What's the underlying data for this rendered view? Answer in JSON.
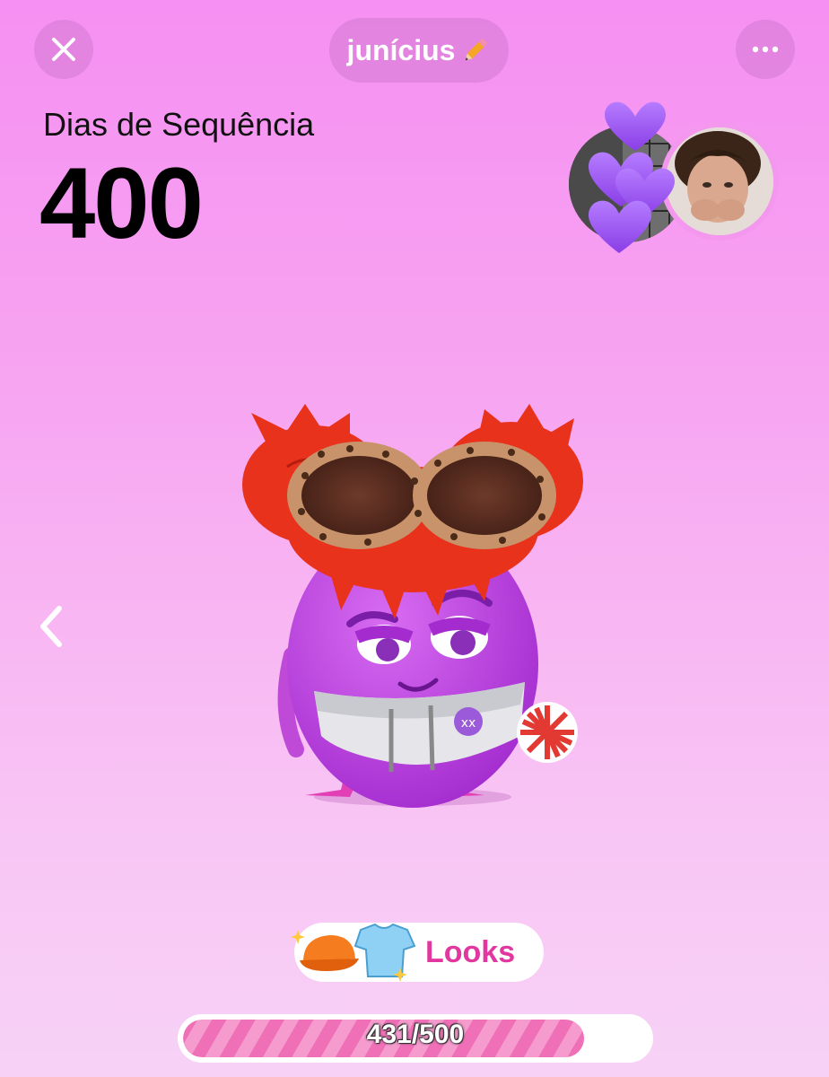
{
  "header": {
    "close_icon": "close-icon",
    "username": "junícius",
    "edit_icon": "pencil-icon",
    "more_icon": "more-dots-icon"
  },
  "streak": {
    "label": "Dias de Sequência",
    "value": "400"
  },
  "friends": {
    "hearts_icon": "purple-hearts-icon"
  },
  "navigation": {
    "back_icon": "chevron-left-icon"
  },
  "looks": {
    "label": "Looks",
    "icons": [
      "cap-icon",
      "tshirt-icon",
      "sparkle-icon"
    ]
  },
  "progress": {
    "text": "431/500",
    "current": 431,
    "max": 500
  },
  "colors": {
    "accent": "#e2379f",
    "background_top": "#f690f2",
    "background_bottom": "#f7d2f6"
  }
}
